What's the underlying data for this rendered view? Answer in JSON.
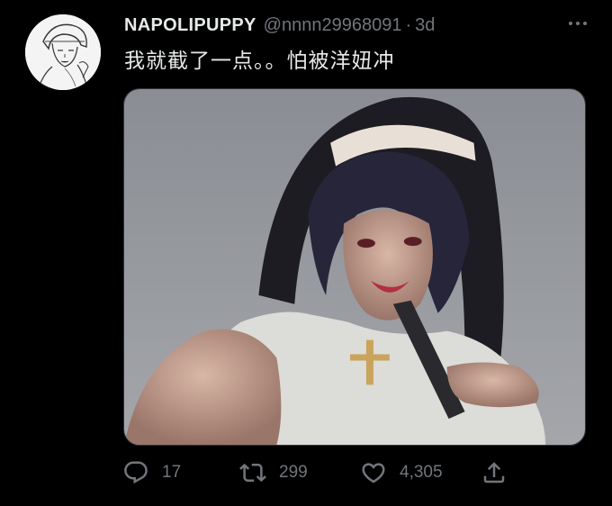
{
  "tweet": {
    "display_name": "NAPOLIPUPPY",
    "handle": "@nnnn29968091",
    "separator": "·",
    "timestamp": "3d",
    "text": "我就截了一点。。怕被洋妞冲"
  },
  "actions": {
    "reply_count": "17",
    "retweet_count": "299",
    "like_count": "4,305"
  },
  "icons": {
    "reply": "reply-icon",
    "retweet": "retweet-icon",
    "like": "heart-icon",
    "share": "share-icon",
    "more": "more-icon"
  },
  "colors": {
    "background": "#000000",
    "text": "#e7e9ea",
    "secondary": "#71767b"
  }
}
